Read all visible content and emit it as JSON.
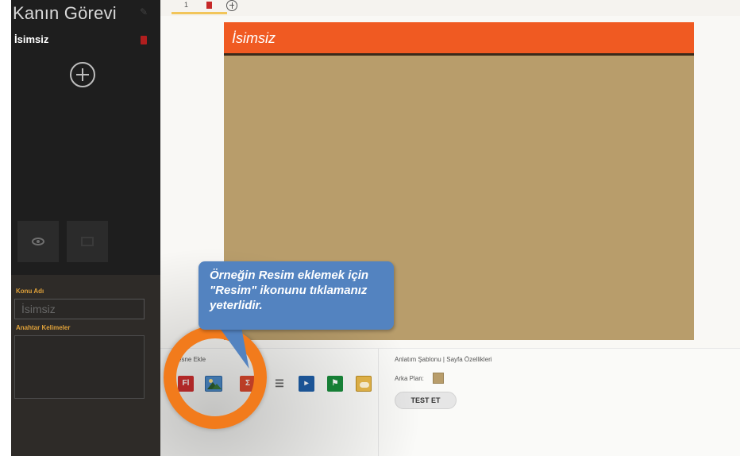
{
  "sidebar": {
    "title": "Kanın Görevi",
    "item_label": "İsimsiz",
    "topic_label": "Konu Adı",
    "topic_placeholder": "İsimsiz",
    "keywords_label": "Anahtar Kelimeler"
  },
  "tabs": {
    "active_number": "1"
  },
  "slide": {
    "title": "İsimsiz",
    "header_color": "#f05a22",
    "background_color": "#b89d6b"
  },
  "object_panel": {
    "label": "esne Ekle",
    "icons": [
      "fl-icon",
      "image-icon",
      "sigma-icon",
      "list-icon",
      "play-icon",
      "flag-icon",
      "cloud-icon"
    ]
  },
  "properties_panel": {
    "title": "Anlatım Şablonu | Sayfa Özellikleri",
    "background_label": "Arka Plan:",
    "test_button": "TEST ET"
  },
  "tutorial": {
    "text": "Örneğin Resim eklemek için \"Resim\" ikonunu tıklamanız yeterlidir.",
    "highlight_color": "#f27b1c",
    "bubble_color": "#5383c0"
  }
}
